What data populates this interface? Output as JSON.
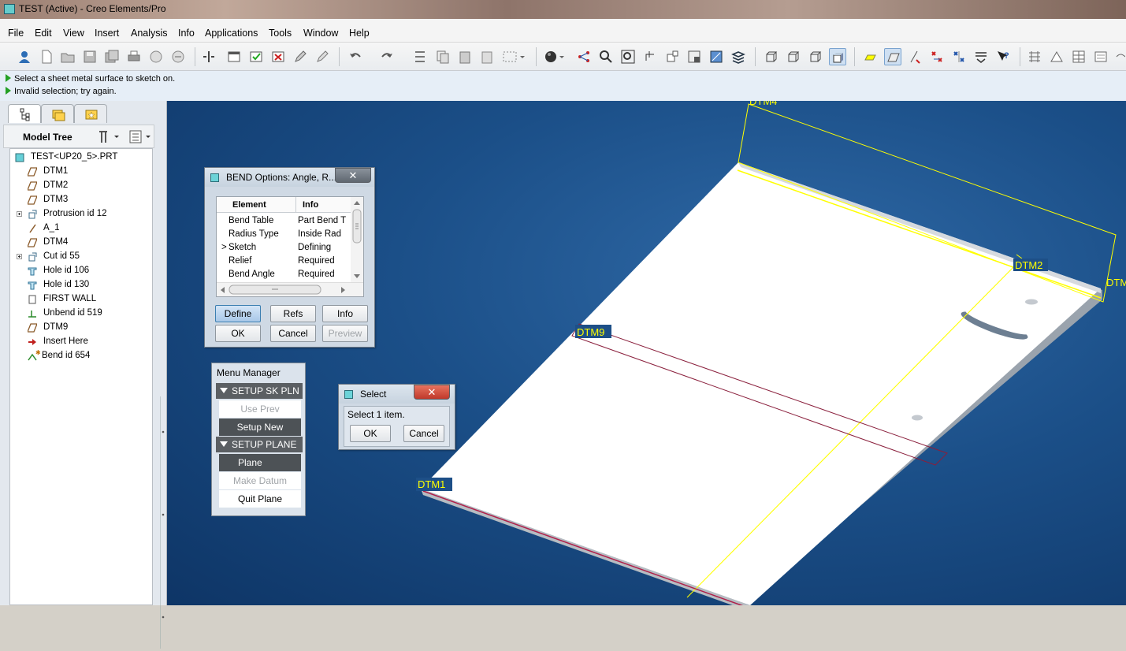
{
  "window": {
    "title": "TEST (Active) - Creo Elements/Pro"
  },
  "menubar": [
    "File",
    "Edit",
    "View",
    "Insert",
    "Analysis",
    "Info",
    "Applications",
    "Tools",
    "Window",
    "Help"
  ],
  "messages": [
    "Select a sheet metal surface to sketch on.",
    "Invalid selection; try again."
  ],
  "model_tree": {
    "title": "Model Tree",
    "items": [
      {
        "label": "TEST<UP20_5>.PRT",
        "icon": "part-icon"
      },
      {
        "label": "DTM1",
        "icon": "datum-plane-icon"
      },
      {
        "label": "DTM2",
        "icon": "datum-plane-icon"
      },
      {
        "label": "DTM3",
        "icon": "datum-plane-icon"
      },
      {
        "label": "Protrusion id 12",
        "icon": "protrusion-icon"
      },
      {
        "label": "A_1",
        "icon": "datum-axis-icon"
      },
      {
        "label": "DTM4",
        "icon": "datum-plane-icon"
      },
      {
        "label": "Cut id 55",
        "icon": "cut-icon"
      },
      {
        "label": "Hole id 106",
        "icon": "hole-icon"
      },
      {
        "label": "Hole id 130",
        "icon": "hole-icon"
      },
      {
        "label": "FIRST WALL",
        "icon": "wall-icon"
      },
      {
        "label": "Unbend id 519",
        "icon": "unbend-icon"
      },
      {
        "label": "DTM9",
        "icon": "datum-plane-icon"
      },
      {
        "label": "Insert Here",
        "icon": "insert-arrow-icon"
      },
      {
        "label": "Bend id 654",
        "icon": "bend-icon"
      }
    ]
  },
  "bend_dialog": {
    "title": "BEND Options: Angle, R...",
    "columns": [
      "Element",
      "Info"
    ],
    "rows": [
      {
        "marker": "",
        "element": "Bend Table",
        "info": "Part Bend T"
      },
      {
        "marker": "",
        "element": "Radius Type",
        "info": "Inside Rad"
      },
      {
        "marker": ">",
        "element": "Sketch",
        "info": "Defining"
      },
      {
        "marker": "",
        "element": "Relief",
        "info": "Required"
      },
      {
        "marker": "",
        "element": "Bend Angle",
        "info": "Required"
      }
    ],
    "buttons": {
      "define": "Define",
      "refs": "Refs",
      "info": "Info",
      "ok": "OK",
      "cancel": "Cancel",
      "preview": "Preview"
    },
    "close": "✕"
  },
  "menu_manager": {
    "title": "Menu Manager",
    "section1": "SETUP SK PLN",
    "use_prev": "Use Prev",
    "setup_new": "Setup New",
    "section2": "SETUP PLANE",
    "plane": "Plane",
    "make_datum": "Make Datum",
    "quit_plane": "Quit Plane"
  },
  "select_dialog": {
    "title": "Select",
    "prompt": "Select 1 item.",
    "ok": "OK",
    "cancel": "Cancel",
    "close": "✕"
  },
  "datum_labels": {
    "dtm4": "DTM4",
    "dtm2": "DTM2",
    "dtm9": "DTM9",
    "dtm1": "DTM1",
    "dtm_edge": "DTM"
  },
  "colors": {
    "viewport_bg": "#1b4f88",
    "datum_yellow": "#ffff00",
    "sketch_plane": "#8a1f3c",
    "close_red": "#c0392b",
    "selected_btn": "#a9c8e8"
  }
}
